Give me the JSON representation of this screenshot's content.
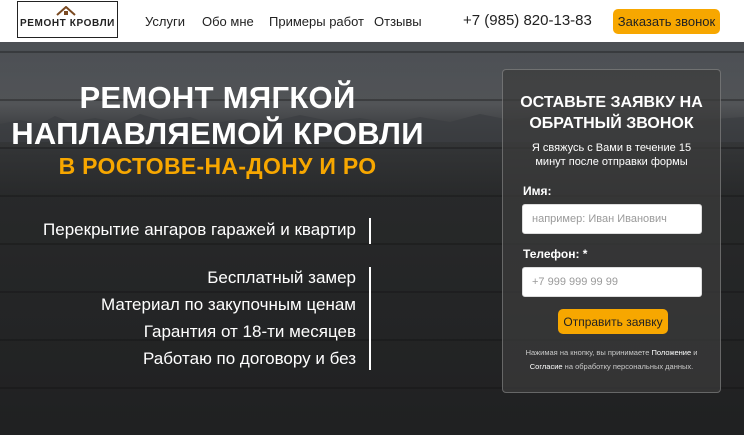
{
  "header": {
    "logo_text": "РЕМОНТ КРОВЛИ",
    "nav": [
      "Услуги",
      "Обо мне",
      "Примеры работ",
      "Отзывы"
    ],
    "phone": "+7 (985) 820-13-83",
    "cta_label": "Заказать звонок"
  },
  "hero": {
    "title_line1": "РЕМОНТ МЯГКОЙ",
    "title_line2": "НАПЛАВЛЯЕМОЙ КРОВЛИ",
    "subtitle": "В РОСТОВЕ-НА-ДОНУ И РО",
    "feature_main": "Перекрытие ангаров гаражей и квартир",
    "features": [
      "Бесплатный замер",
      "Материал по закупочным ценам",
      "Гарантия от 18-ти месяцев",
      "Работаю по договору и без"
    ]
  },
  "form": {
    "title_line1": "ОСТАВЬТЕ ЗАЯВКУ НА",
    "title_line2": "ОБРАТНЫЙ ЗВОНОК",
    "desc_line1": "Я свяжусь с Вами в течение 15",
    "desc_line2": "минут после отправки формы",
    "name_label": "Имя:",
    "name_placeholder": "например: Иван Иванович",
    "phone_label": "Телефон: *",
    "phone_placeholder": "+7 999 999 99 99",
    "submit_label": "Отправить заявку",
    "consent_prefix": "Нажимая на кнопку, вы принимаете",
    "consent_link1": "Положение",
    "consent_and": "и",
    "consent_link2": "Согласие",
    "consent_suffix": "на обработку персональных данных."
  },
  "colors": {
    "accent": "#f7a700"
  }
}
